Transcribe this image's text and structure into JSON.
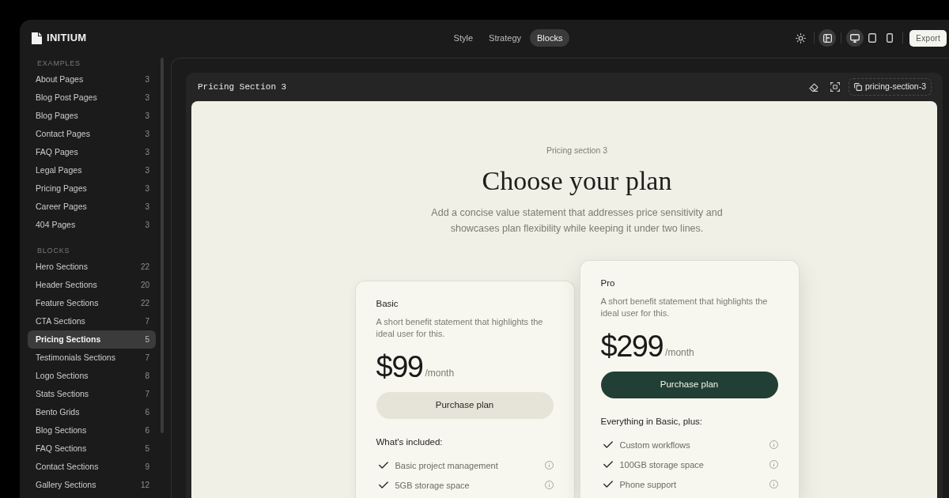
{
  "app": {
    "logo": "INITIUM"
  },
  "tabs": [
    {
      "label": "Style",
      "selected": false
    },
    {
      "label": "Strategy",
      "selected": false
    },
    {
      "label": "Blocks",
      "selected": true
    }
  ],
  "toolbar": {
    "layout_toggle": {
      "on": true
    },
    "devices": [
      {
        "kind": "desktop",
        "selected": true
      },
      {
        "kind": "tablet",
        "selected": false
      },
      {
        "kind": "phone",
        "selected": false
      }
    ],
    "export_button": "Export"
  },
  "sidebar": {
    "groups": [
      {
        "heading": "EXAMPLES",
        "items": [
          {
            "label": "About Pages",
            "count": "3",
            "selected": false
          },
          {
            "label": "Blog Post Pages",
            "count": "3",
            "selected": false
          },
          {
            "label": "Blog Pages",
            "count": "3",
            "selected": false
          },
          {
            "label": "Contact Pages",
            "count": "3",
            "selected": false
          },
          {
            "label": "FAQ Pages",
            "count": "3",
            "selected": false
          },
          {
            "label": "Legal Pages",
            "count": "3",
            "selected": false
          },
          {
            "label": "Pricing Pages",
            "count": "3",
            "selected": false
          },
          {
            "label": "Career Pages",
            "count": "3",
            "selected": false
          },
          {
            "label": "404 Pages",
            "count": "3",
            "selected": false
          }
        ]
      },
      {
        "heading": "BLOCKS",
        "items": [
          {
            "label": "Hero Sections",
            "count": "22",
            "selected": false
          },
          {
            "label": "Header Sections",
            "count": "20",
            "selected": false
          },
          {
            "label": "Feature Sections",
            "count": "22",
            "selected": false
          },
          {
            "label": "CTA Sections",
            "count": "7",
            "selected": false
          },
          {
            "label": "Pricing Sections",
            "count": "5",
            "selected": true
          },
          {
            "label": "Testimonials Sections",
            "count": "7",
            "selected": false
          },
          {
            "label": "Logo Sections",
            "count": "8",
            "selected": false
          },
          {
            "label": "Stats Sections",
            "count": "7",
            "selected": false
          },
          {
            "label": "Bento Grids",
            "count": "6",
            "selected": false
          },
          {
            "label": "Blog Sections",
            "count": "6",
            "selected": false
          },
          {
            "label": "FAQ Sections",
            "count": "5",
            "selected": false
          },
          {
            "label": "Contact Sections",
            "count": "9",
            "selected": false
          },
          {
            "label": "Gallery Sections",
            "count": "12",
            "selected": false
          }
        ]
      }
    ]
  },
  "block": {
    "title": "Pricing Section 3",
    "copy_button": "pricing-section-3"
  },
  "preview": {
    "eyebrow": "Pricing section 3",
    "heading": "Choose your plan",
    "description": "Add a concise value statement that addresses price sensitivity and showcases plan flexibility while keeping it under two lines.",
    "plans": [
      {
        "name": "Basic",
        "description": "A short benefit statement that highlights the ideal user for this.",
        "price": "$99",
        "period": "/month",
        "button": "Purchase plan",
        "highlighted": false,
        "features_heading": "What's included:",
        "features": [
          "Basic project management",
          "5GB storage space"
        ]
      },
      {
        "name": "Pro",
        "description": "A short benefit statement that highlights the ideal user for this.",
        "price": "$299",
        "period": "/month",
        "button": "Purchase plan",
        "highlighted": true,
        "features_heading": "Everything in Basic, plus:",
        "features": [
          "Custom workflows",
          "100GB storage space",
          "Phone support"
        ]
      }
    ]
  }
}
